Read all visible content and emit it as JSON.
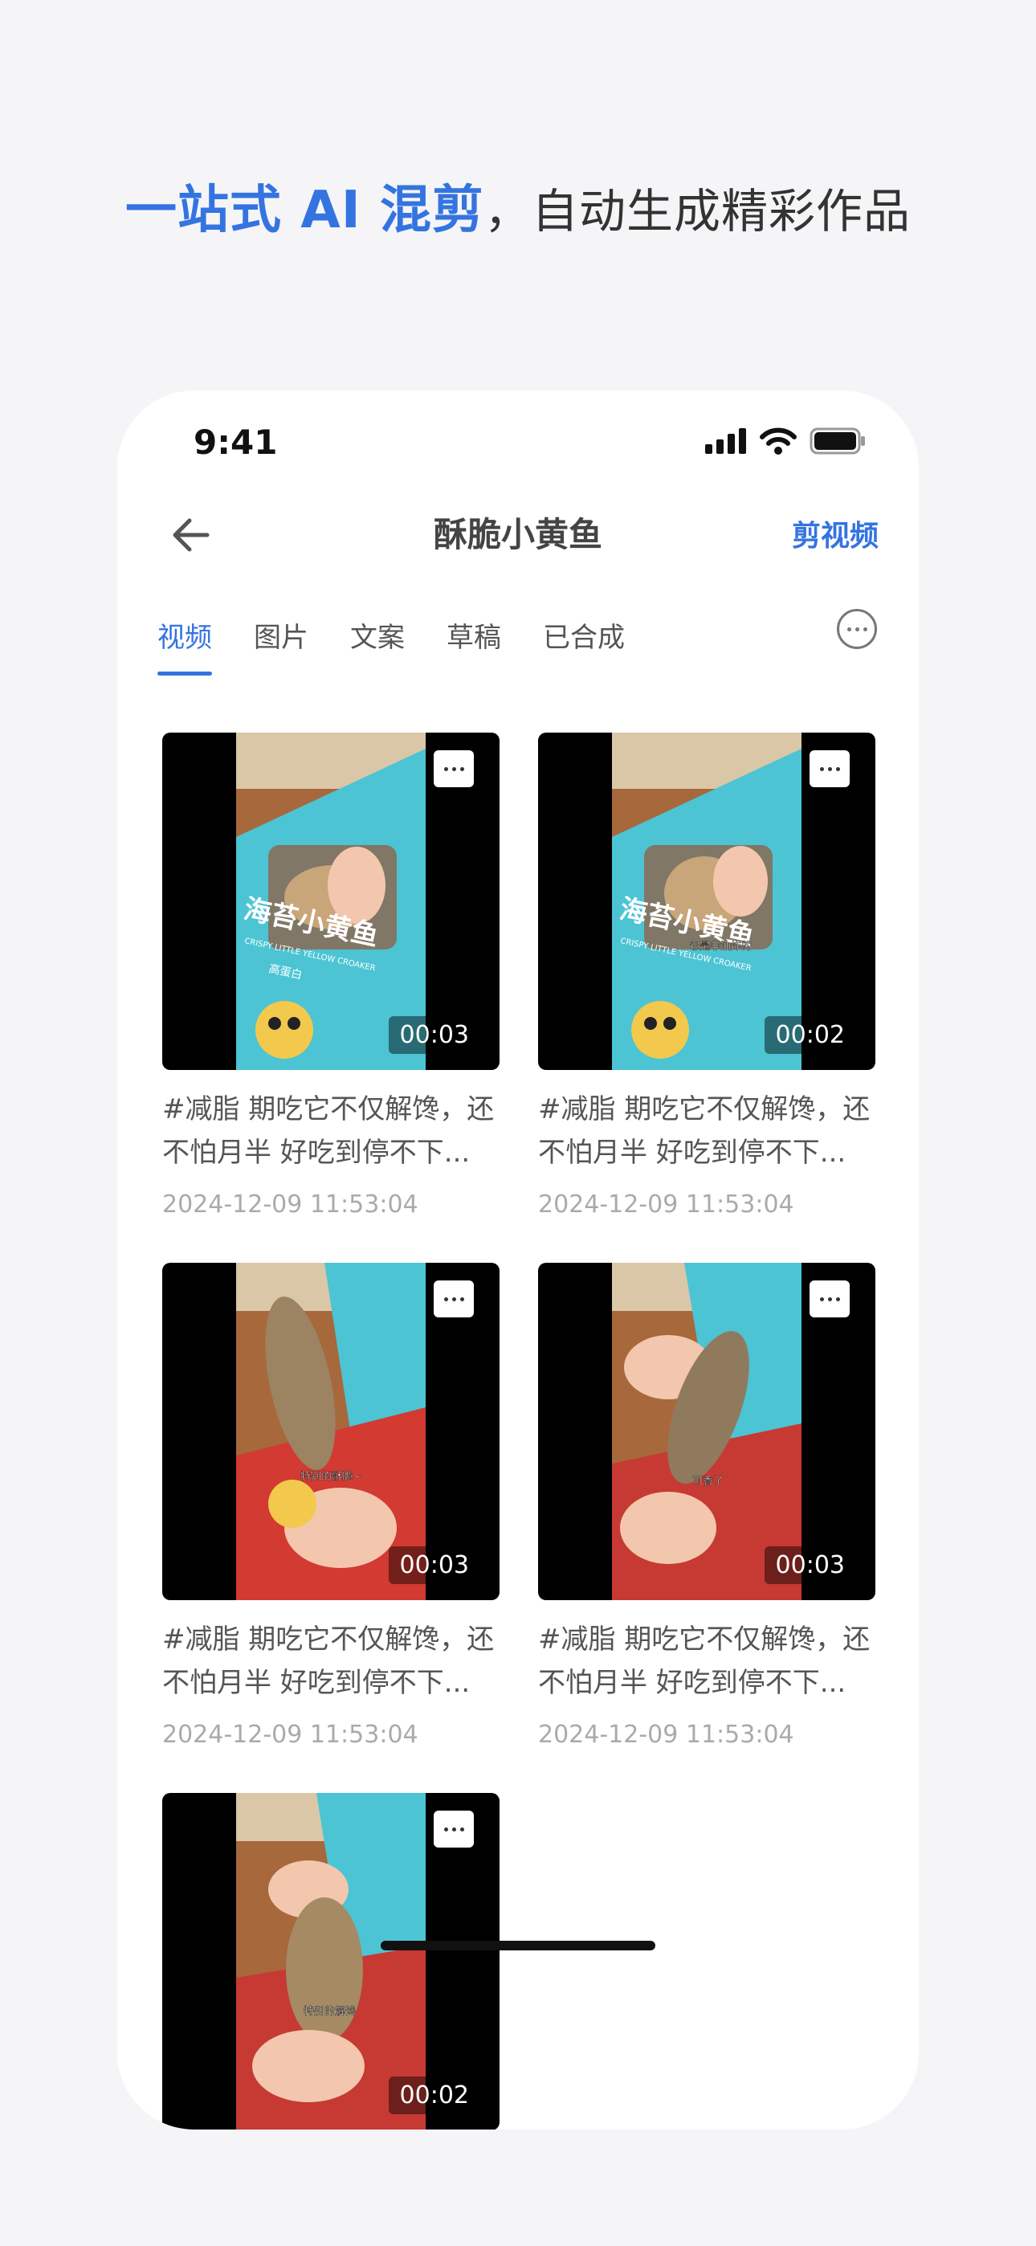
{
  "headline": {
    "accent": "一站式 AI 混剪",
    "rest": "，自动生成精彩作品"
  },
  "status": {
    "time": "9:41"
  },
  "nav": {
    "title": "酥脆小黄鱼",
    "action": "剪视频"
  },
  "tabs": [
    "视频",
    "图片",
    "文案",
    "草稿",
    "已合成"
  ],
  "active_tab": 0,
  "colors": {
    "accent": "#3374e0"
  },
  "videos": [
    {
      "duration": "00:03",
      "caption": "#减脂 期吃它不仅解馋，还不怕月半 好吃到停不下...",
      "date": "2024-12-09 11:53:04",
      "overlay": ""
    },
    {
      "duration": "00:02",
      "caption": "#减脂 期吃它不仅解馋，还不怕月半 好吃到停不下...",
      "date": "2024-12-09 11:53:04",
      "overlay": "它是非油炸的"
    },
    {
      "duration": "00:03",
      "caption": "#减脂 期吃它不仅解馋，还不怕月半 好吃到停不下...",
      "date": "2024-12-09 11:53:04",
      "overlay": "特别的酥脆~"
    },
    {
      "duration": "00:03",
      "caption": "#减脂 期吃它不仅解馋，还不怕月半 好吃到停不下...",
      "date": "2024-12-09 11:53:04",
      "overlay": "可香了"
    },
    {
      "duration": "00:02",
      "caption": "",
      "date": "",
      "overlay": "特别的解馋"
    }
  ],
  "packaging": {
    "brand": "海苔小黄鱼",
    "sub": "CRISPY LITTLE YELLOW CROAKER",
    "tag": "高蛋白"
  },
  "icons": [
    "back-arrow-icon",
    "more-circle-icon",
    "more-dots-icon",
    "signal-icon",
    "wifi-icon",
    "battery-icon"
  ]
}
